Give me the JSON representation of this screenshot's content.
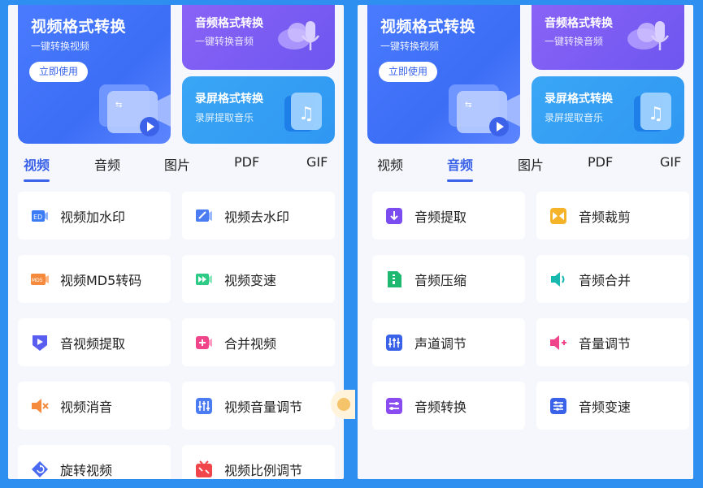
{
  "left": {
    "banner_big": {
      "title": "视频格式转换",
      "subtitle": "一键转换视频",
      "button": "立即使用"
    },
    "banner_audio": {
      "title": "音频格式转换",
      "subtitle": "一键转换音频"
    },
    "banner_screen": {
      "title": "录屏格式转换",
      "subtitle": "录屏提取音乐"
    },
    "tabs": [
      "视频",
      "音频",
      "图片",
      "PDF",
      "GIF"
    ],
    "active_tab": 0,
    "items": [
      {
        "label": "视频加水印",
        "icon": "video-watermark-icon",
        "color": "#3b7bf5"
      },
      {
        "label": "视频去水印",
        "icon": "remove-watermark-icon",
        "color": "#4b7cf2"
      },
      {
        "label": "视频MD5转码",
        "icon": "md5-transcode-icon",
        "color": "#f58a3c"
      },
      {
        "label": "视频变速",
        "icon": "video-speed-icon",
        "color": "#2ecb86"
      },
      {
        "label": "音视频提取",
        "icon": "av-extract-icon",
        "color": "#5a5ef0"
      },
      {
        "label": "合并视频",
        "icon": "merge-video-icon",
        "color": "#f0458a"
      },
      {
        "label": "视频消音",
        "icon": "mute-video-icon",
        "color": "#f58a3c"
      },
      {
        "label": "视频音量调节",
        "icon": "video-volume-icon",
        "color": "#4b7cf2"
      },
      {
        "label": "旋转视频",
        "icon": "rotate-video-icon",
        "color": "#4b6af2"
      },
      {
        "label": "视频比例调节",
        "icon": "video-ratio-icon",
        "color": "#f0454a"
      }
    ]
  },
  "right": {
    "banner_big": {
      "title": "视频格式转换",
      "subtitle": "一键转换视频",
      "button": "立即使用"
    },
    "banner_audio": {
      "title": "音频格式转换",
      "subtitle": "一键转换音频"
    },
    "banner_screen": {
      "title": "录屏格式转换",
      "subtitle": "录屏提取音乐"
    },
    "tabs": [
      "视频",
      "音频",
      "图片",
      "PDF",
      "GIF"
    ],
    "active_tab": 1,
    "items": [
      {
        "label": "音频提取",
        "icon": "audio-extract-icon",
        "color": "#7b4cf0"
      },
      {
        "label": "音频裁剪",
        "icon": "audio-trim-icon",
        "color": "#f5b32a"
      },
      {
        "label": "音频压缩",
        "icon": "audio-compress-icon",
        "color": "#1fb870"
      },
      {
        "label": "音频合并",
        "icon": "audio-merge-icon",
        "color": "#17b8b0"
      },
      {
        "label": "声道调节",
        "icon": "channel-adjust-icon",
        "color": "#3a62e8"
      },
      {
        "label": "音量调节",
        "icon": "volume-adjust-icon",
        "color": "#f0458a"
      },
      {
        "label": "音频转换",
        "icon": "audio-convert-icon",
        "color": "#8a4cf0"
      },
      {
        "label": "音频变速",
        "icon": "audio-speed-icon",
        "color": "#3a62e8"
      }
    ]
  }
}
